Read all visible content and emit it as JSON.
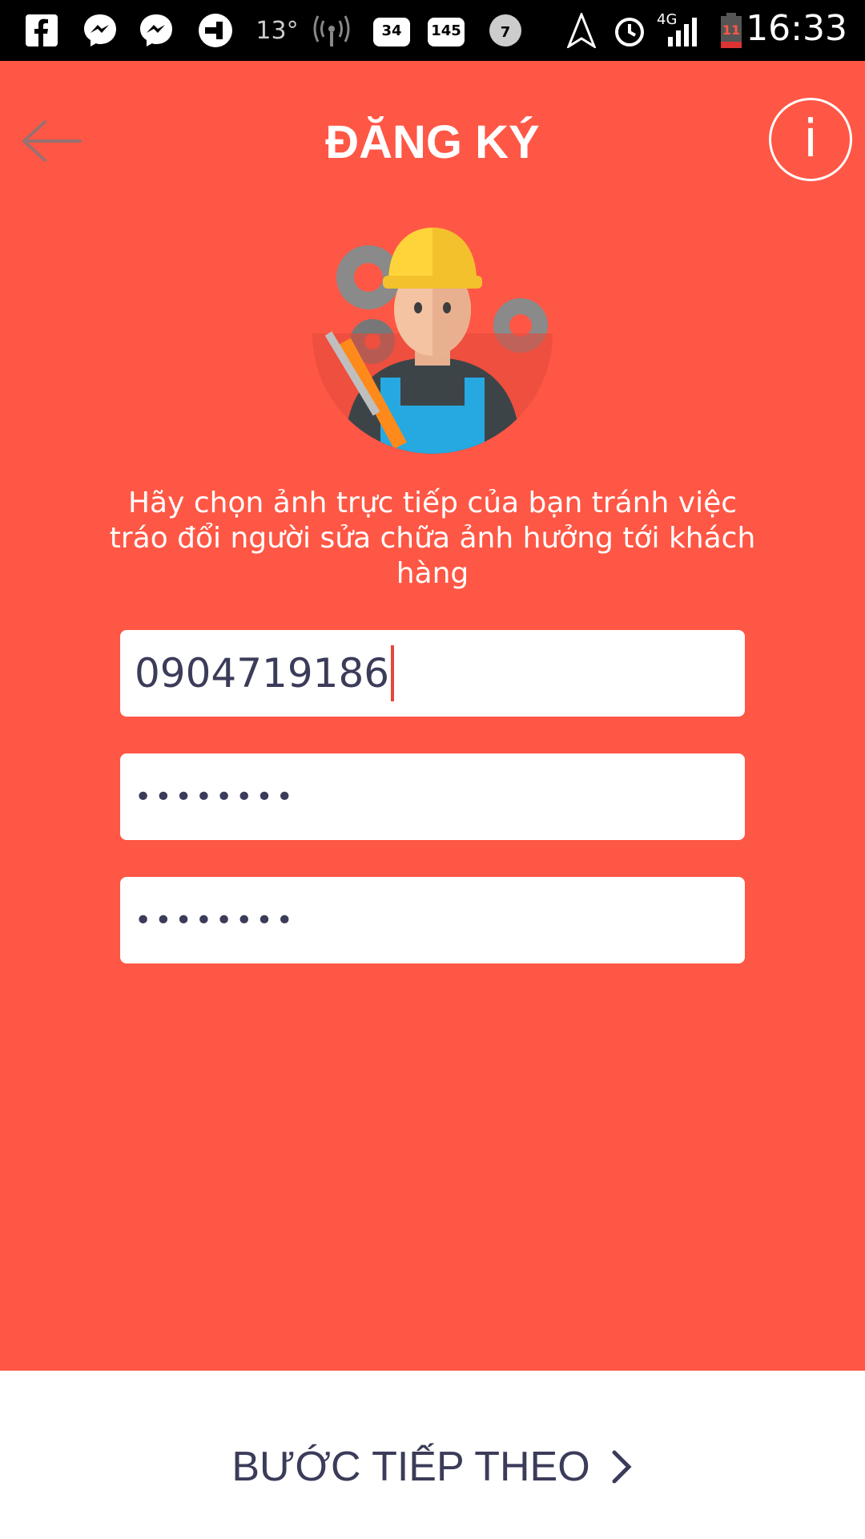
{
  "status_bar": {
    "temperature": "13°",
    "badge_mail": "34",
    "badge_mail2": "145",
    "badge_chat": "7",
    "network": "4G",
    "battery": "11",
    "time": "16:33"
  },
  "header": {
    "title": "ĐĂNG KÝ"
  },
  "instruction": "Hãy chọn ảnh trực tiếp của bạn tránh việc tráo đổi người sửa chữa ảnh hưởng tới khách hàng",
  "form": {
    "phone_value": "0904719186",
    "password_value": "••••••••",
    "confirm_password_value": "••••••••"
  },
  "footer": {
    "next_label": "BƯỚC TIẾP THEO"
  },
  "colors": {
    "primary": "#ff5745",
    "text_dark": "#3b3b5a",
    "white": "#ffffff"
  }
}
